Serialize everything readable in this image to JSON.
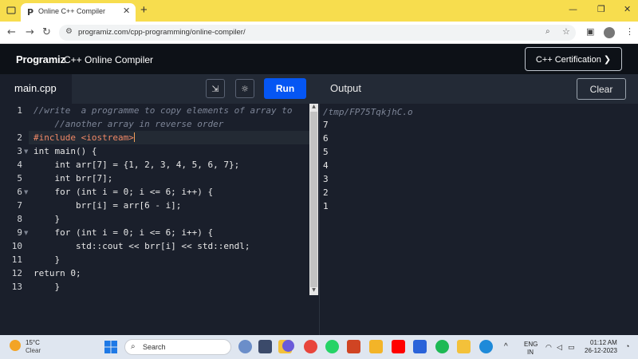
{
  "browser": {
    "tab_title": "Online C++ Compiler",
    "tab_favicon": "P",
    "url": "programiz.com/cpp-programming/online-compiler/"
  },
  "header": {
    "logo": "Programiz",
    "title": "C++ Online Compiler",
    "certification_label": "C++ Certification ❯"
  },
  "editor": {
    "file_name": "main.cpp",
    "run_label": "Run",
    "lines": [
      {
        "n": "1",
        "text": "//write  a programme to copy elements of array to"
      },
      {
        "n": "",
        "text": "    //another array in reverse order"
      },
      {
        "n": "2",
        "text": "#include <iostream>"
      },
      {
        "n": "3",
        "text": "int main() {"
      },
      {
        "n": "4",
        "text": "    int arr[7] = {1, 2, 3, 4, 5, 6, 7};"
      },
      {
        "n": "5",
        "text": "    int brr[7];"
      },
      {
        "n": "6",
        "text": "    for (int i = 0; i <= 6; i++) {"
      },
      {
        "n": "7",
        "text": "        brr[i] = arr[6 - i];"
      },
      {
        "n": "8",
        "text": "    }"
      },
      {
        "n": "9",
        "text": "    for (int i = 0; i <= 6; i++) {"
      },
      {
        "n": "10",
        "text": "        std::cout << brr[i] << std::endl;"
      },
      {
        "n": "11",
        "text": "    }"
      },
      {
        "n": "12",
        "text": "return 0;"
      },
      {
        "n": "13",
        "text": "    }"
      }
    ]
  },
  "output": {
    "title": "Output",
    "clear_label": "Clear",
    "path": "/tmp/FP75TqkjhC.o",
    "lines": [
      "7",
      "6",
      "5",
      "4",
      "3",
      "2",
      "1"
    ]
  },
  "taskbar": {
    "weather_temp": "15°C",
    "weather_desc": "Clear",
    "search_placeholder": "Search",
    "lang_top": "ENG",
    "lang_bottom": "IN",
    "time": "01:12 AM",
    "date": "26-12-2023"
  },
  "colors": {
    "accent": "#f7dd4e",
    "run": "#0556f3",
    "editor_bg": "#1a1f2b"
  }
}
